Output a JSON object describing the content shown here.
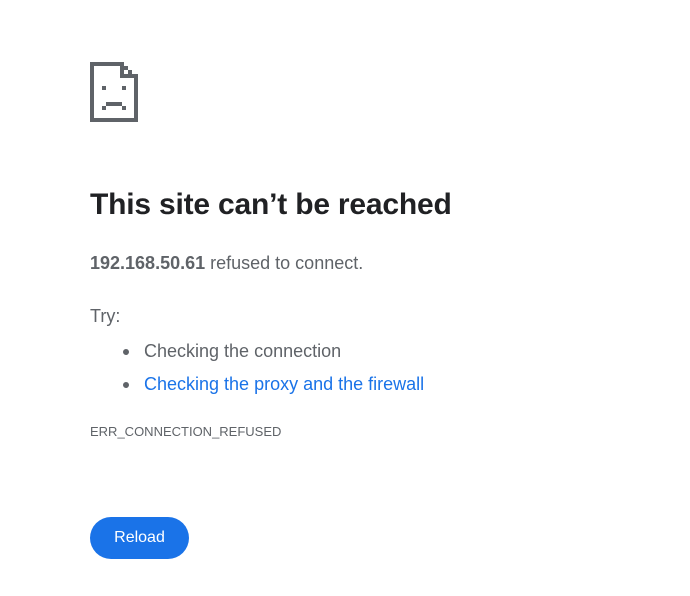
{
  "error_page": {
    "icon": "sad-document-icon",
    "title": "This site can’t be reached",
    "host": "192.168.50.61",
    "summary_suffix": " refused to connect.",
    "try_label": "Try:",
    "suggestions": [
      {
        "label": "Checking the connection",
        "is_link": false
      },
      {
        "label": "Checking the proxy and the firewall",
        "is_link": true
      }
    ],
    "error_code": "ERR_CONNECTION_REFUSED",
    "reload_label": "Reload"
  },
  "colors": {
    "heading": "#202124",
    "body_text": "#5f6368",
    "link": "#1a73e8",
    "button_bg": "#1a73e8",
    "button_text": "#ffffff",
    "icon": "#5f6368"
  }
}
